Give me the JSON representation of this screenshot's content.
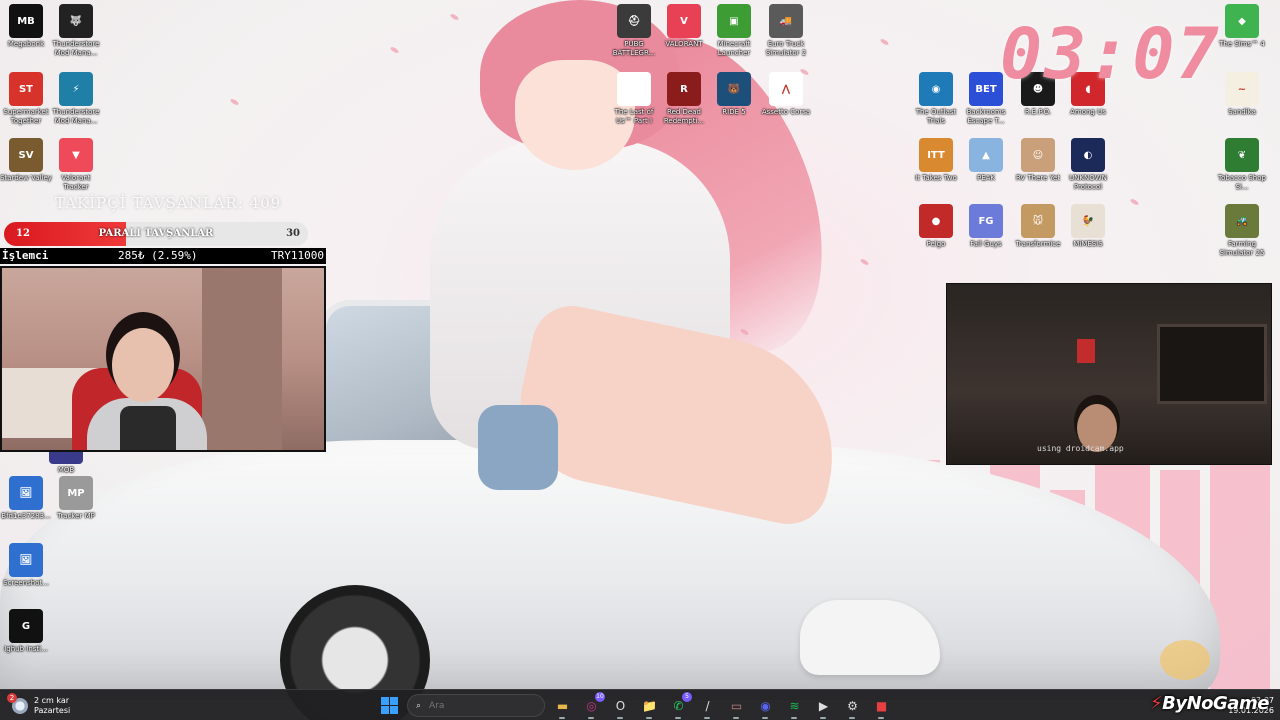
{
  "clock": {
    "time": "03:07"
  },
  "overlay": {
    "follower_goal": "TAKİPÇİ TAVŞANLAR: 409",
    "sub_goal": {
      "current": "12",
      "label": "PARALI TAVŞANLAR",
      "target": "30",
      "progress": 0.4
    },
    "ticker": {
      "left": "İşlemci",
      "change": "285₺ (2.59%)",
      "total": "TRY11000"
    }
  },
  "webcam_right": {
    "caption": "using droidcam.app"
  },
  "desktop_left": [
    {
      "label": "Megabonk",
      "icon": "megabonk-icon",
      "color": "#111111",
      "glyph": "MB"
    },
    {
      "label": "Thunderstore Mod Mana...",
      "icon": "wolf-icon",
      "color": "#222222",
      "glyph": "🐺"
    },
    {
      "label": "Supermarket Together",
      "icon": "supermarket-icon",
      "color": "#d8332b",
      "glyph": "ST"
    },
    {
      "label": "Thunderstore Mod Mana...",
      "icon": "thunderstore-icon",
      "color": "#1f7fa6",
      "glyph": "⚡"
    },
    {
      "label": "Stardew Valley",
      "icon": "stardew-icon",
      "color": "#7a5a2f",
      "glyph": "SV"
    },
    {
      "label": "Valorant Tracker",
      "icon": "valorant-tracker-icon",
      "color": "#ef4a5a",
      "glyph": "▼"
    },
    {
      "label": "MOB",
      "icon": "mob-icon",
      "color": "#3a3a8a",
      "glyph": ""
    },
    {
      "label": "Bfd1e37283...",
      "icon": "file-icon",
      "color": "#2f6fcf",
      "glyph": "🖼"
    },
    {
      "label": "Tracker MP",
      "icon": "tracker-mp-icon",
      "color": "#9a9a9a",
      "glyph": "MP"
    },
    {
      "label": "Screenshot...",
      "icon": "screenshot-file-icon",
      "color": "#2f6fcf",
      "glyph": "🖼"
    },
    {
      "label": "Ighub Insti...",
      "icon": "lghub-icon",
      "color": "#111111",
      "glyph": "G"
    }
  ],
  "desktop_mid": [
    {
      "label": "PUBG BATTLEGR...",
      "icon": "pubg-icon",
      "color": "#3b3b3b",
      "glyph": "⛑"
    },
    {
      "label": "VALORANT",
      "icon": "valorant-icon",
      "color": "#e84155",
      "glyph": "V"
    },
    {
      "label": "Minecraft Launcher",
      "icon": "minecraft-icon",
      "color": "#3e9c35",
      "glyph": "▣"
    },
    {
      "label": "Euro Truck Simulator 2",
      "icon": "eurotruck-icon",
      "color": "#5a5a5a",
      "glyph": "🚚"
    },
    {
      "label": "The Last of Us™ Part I",
      "icon": "tlou-icon",
      "color": "#ffffff",
      "glyph": ""
    },
    {
      "label": "Red Dead Redempti...",
      "icon": "rdr-icon",
      "color": "#8a1c1c",
      "glyph": "R"
    },
    {
      "label": "RIDE 5",
      "icon": "ride5-icon",
      "color": "#1c4f7a",
      "glyph": "🐻"
    },
    {
      "label": "Assetto Corsa",
      "icon": "assetto-icon",
      "color": "#ffffff",
      "glyph": "⋀"
    }
  ],
  "desktop_right": [
    {
      "label": "The Outlast Trials",
      "icon": "outlast-icon",
      "color": "#1e7bb8",
      "glyph": "◉"
    },
    {
      "label": "Backrooms Escape T...",
      "icon": "backrooms-icon",
      "color": "#2c4fd8",
      "glyph": "BET"
    },
    {
      "label": "R.E.P.O.",
      "icon": "repo-icon",
      "color": "#1a1a1a",
      "glyph": "☻"
    },
    {
      "label": "Among Us",
      "icon": "amongus-icon",
      "color": "#d1262b",
      "glyph": "◖"
    },
    {
      "label": "It Takes Two",
      "icon": "ittakestwo-icon",
      "color": "#d9892f",
      "glyph": "ITT"
    },
    {
      "label": "PEAK",
      "icon": "peak-icon",
      "color": "#8ab4e0",
      "glyph": "▲"
    },
    {
      "label": "RV There Yet",
      "icon": "rvthereyet-icon",
      "color": "#c9a07a",
      "glyph": "☺"
    },
    {
      "label": "UNKNOWN Protocol",
      "icon": "unknown-protocol-icon",
      "color": "#1c2a5a",
      "glyph": "◐"
    },
    {
      "label": "Pelgo",
      "icon": "pelgo-icon",
      "color": "#c22a2a",
      "glyph": "●"
    },
    {
      "label": "Fall Guys",
      "icon": "fallguys-icon",
      "color": "#6c7bd9",
      "glyph": "FG"
    },
    {
      "label": "Transformice",
      "icon": "transformice-icon",
      "color": "#c49a63",
      "glyph": "🐭"
    },
    {
      "label": "MiMESIS",
      "icon": "mimesis-icon",
      "color": "#e8e0d4",
      "glyph": "🐓"
    }
  ],
  "desktop_far_right": [
    {
      "label": "The Sims™ 4",
      "icon": "sims-icon",
      "color": "#3fb34f",
      "glyph": "◆"
    },
    {
      "label": "Sandika",
      "icon": "sandika-icon",
      "color": "#f4efe0",
      "glyph": "~"
    },
    {
      "label": "Tobacco Shop Si...",
      "icon": "tobacco-icon",
      "color": "#2e7d32",
      "glyph": "❦"
    },
    {
      "label": "Farming Simulator 25",
      "icon": "farming-icon",
      "color": "#6a7a3a",
      "glyph": "🚜"
    }
  ],
  "taskbar": {
    "weather_temp": "2 cm kar",
    "weather_day": "Pazartesi",
    "weather_badge": "2",
    "search_placeholder": "Ara",
    "apps": [
      {
        "name": "file-explorer-button",
        "icon": "folder-icon",
        "color": "#e6b84a",
        "glyph": "▬"
      },
      {
        "name": "instagram-button",
        "icon": "instagram-icon",
        "color": "#c13584",
        "glyph": "◎",
        "badge": "10"
      },
      {
        "name": "opera-button",
        "icon": "opera-icon",
        "color": "#2b2b2d",
        "glyph": "O"
      },
      {
        "name": "folder-button",
        "icon": "folder-icon",
        "color": "#f0c040",
        "glyph": "📁"
      },
      {
        "name": "whatsapp-button",
        "icon": "whatsapp-icon",
        "color": "#25d366",
        "glyph": "✆",
        "badge": "5"
      },
      {
        "name": "app-red-button",
        "icon": "brush-icon",
        "color": "#2b2b2d",
        "glyph": "/"
      },
      {
        "name": "photos-button",
        "icon": "photos-icon",
        "color": "#c08080",
        "glyph": "▭"
      },
      {
        "name": "discord-button",
        "icon": "discord-icon",
        "color": "#5865f2",
        "glyph": "◉"
      },
      {
        "name": "spotify-button",
        "icon": "spotify-icon",
        "color": "#1db954",
        "glyph": "≋"
      },
      {
        "name": "game-launcher-button",
        "icon": "play-icon",
        "color": "#2b2b2d",
        "glyph": "▶"
      },
      {
        "name": "steam-button",
        "icon": "steam-icon",
        "color": "#2b2b2d",
        "glyph": "⚙"
      },
      {
        "name": "recorder-button",
        "icon": "record-icon",
        "color": "#e84040",
        "glyph": "■"
      }
    ],
    "tray_time": "03:07",
    "tray_date": "19.01.2026"
  },
  "watermark": {
    "text": "ByNoGame"
  }
}
